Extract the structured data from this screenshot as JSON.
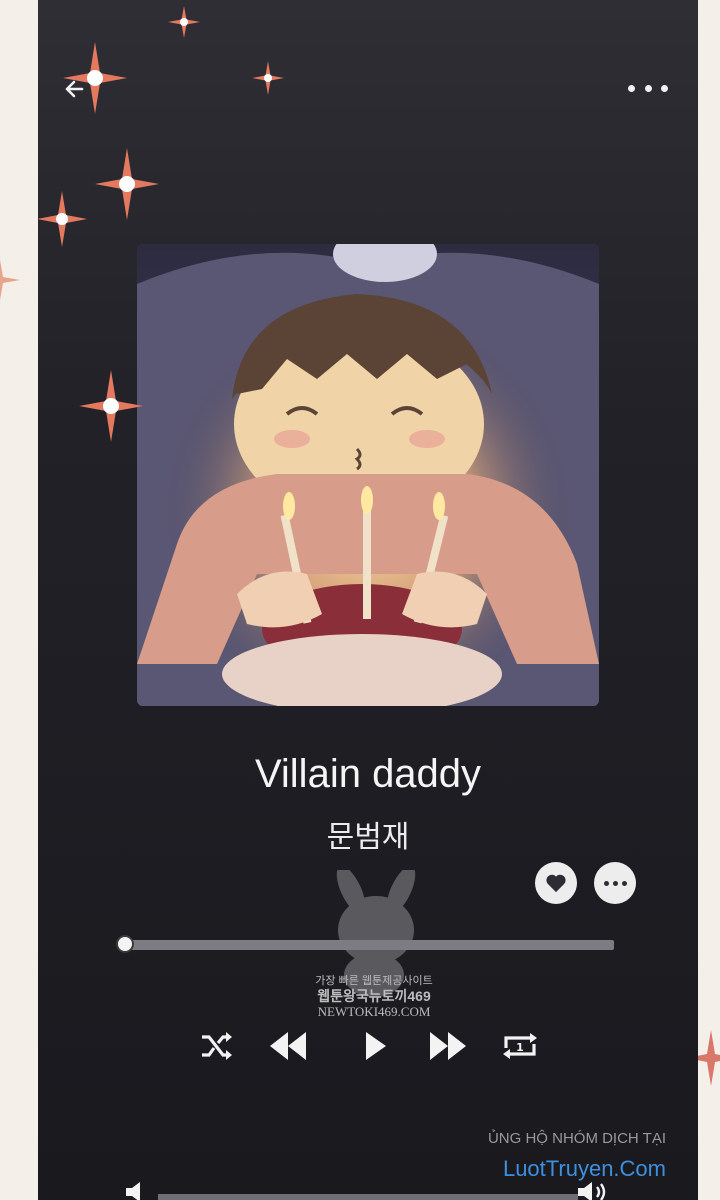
{
  "player": {
    "title": "Villain daddy",
    "artist": "문범재",
    "icons": {
      "back": "back-arrow-icon",
      "menu": "more-horizontal-icon",
      "like": "heart-icon",
      "options": "more-horizontal-icon",
      "shuffle": "shuffle-icon",
      "previous": "rewind-icon",
      "play": "play-icon",
      "next": "fast-forward-icon",
      "repeat": "repeat-one-icon",
      "volume_down": "volume-low-icon",
      "volume_up": "volume-high-icon"
    },
    "progress": 0,
    "colors": {
      "accent": "#f3f3f3",
      "background": "#1c1c21",
      "link": "#3d8fe0"
    }
  },
  "watermark": {
    "line1": "가장 빠른 웹툰제공사이트",
    "line2": "웹툰왕국뉴토끼469",
    "line3": "NEWTOKI469.COM"
  },
  "credit": {
    "line1": "ỦNG HỘ NHÓM DỊCH TẠI",
    "line2": "LuotTruyen.Com"
  }
}
